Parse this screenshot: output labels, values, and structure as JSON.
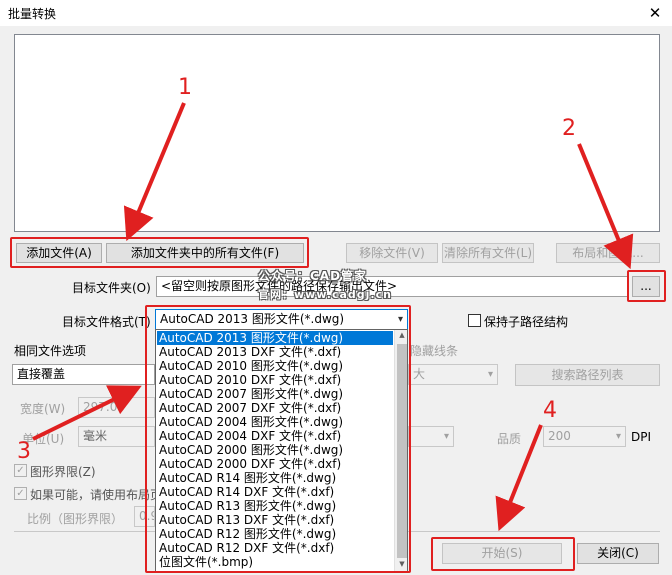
{
  "window": {
    "title": "批量转换",
    "close_glyph": "✕"
  },
  "file_buttons": {
    "add_file": "添加文件(A)",
    "add_folder_files": "添加文件夹中的所有文件(F)",
    "remove_file": "移除文件(V)",
    "clear_all": "清除所有文件(L)",
    "layout": "布局和图纸..."
  },
  "target_folder": {
    "label": "目标文件夹(O)",
    "value": "<留空则按原图形文件的路径保存输出文件>",
    "browse": "..."
  },
  "target_format": {
    "label": "目标文件格式(T)",
    "selected": "AutoCAD 2013 图形文件(*.dwg)",
    "options": [
      "AutoCAD 2013 图形文件(*.dwg)",
      "AutoCAD 2013 DXF 文件(*.dxf)",
      "AutoCAD 2010 图形文件(*.dwg)",
      "AutoCAD 2010 DXF 文件(*.dxf)",
      "AutoCAD 2007 图形文件(*.dwg)",
      "AutoCAD 2007 DXF 文件(*.dxf)",
      "AutoCAD 2004 图形文件(*.dwg)",
      "AutoCAD 2004 DXF 文件(*.dxf)",
      "AutoCAD 2000 图形文件(*.dwg)",
      "AutoCAD 2000 DXF 文件(*.dxf)",
      "AutoCAD R14 图形文件(*.dwg)",
      "AutoCAD R14 DXF 文件(*.dxf)",
      "AutoCAD R13 图形文件(*.dwg)",
      "AutoCAD R13 DXF 文件(*.dxf)",
      "AutoCAD R12 图形文件(*.dwg)",
      "AutoCAD R12 DXF 文件(*.dxf)",
      "位图文件(*.bmp)"
    ]
  },
  "keep_subpath": {
    "label": "保持子路径结构",
    "checked": false
  },
  "same_file_options": {
    "label": "相同文件选项",
    "value": "直接覆盖"
  },
  "hidden_lines": {
    "label": "隐藏线条",
    "value": "大"
  },
  "search_paths": {
    "label": "搜索路径列表"
  },
  "width": {
    "label": "宽度(W)",
    "value": "297.00"
  },
  "unit": {
    "label": "单位(U)",
    "value": "毫米"
  },
  "quality": {
    "label": "品质",
    "value": "200",
    "unit": "DPI"
  },
  "drawing_limits": {
    "label": "图形界限(Z)",
    "checked": true
  },
  "use_layout": {
    "label": "如果可能，请使用布局页",
    "checked": true
  },
  "scale": {
    "label": "比例（图形界限）",
    "value": "0.9"
  },
  "actions": {
    "start": "开始(S)",
    "close": "关闭(C)"
  },
  "watermark": {
    "line1": "公众号：CAD管家",
    "line2": "官网：www.cadgj.cn"
  },
  "annotations": [
    "1",
    "2",
    "3",
    "4"
  ],
  "colors": {
    "annotation_red": "#e02020",
    "selection_blue": "#0078d7"
  }
}
